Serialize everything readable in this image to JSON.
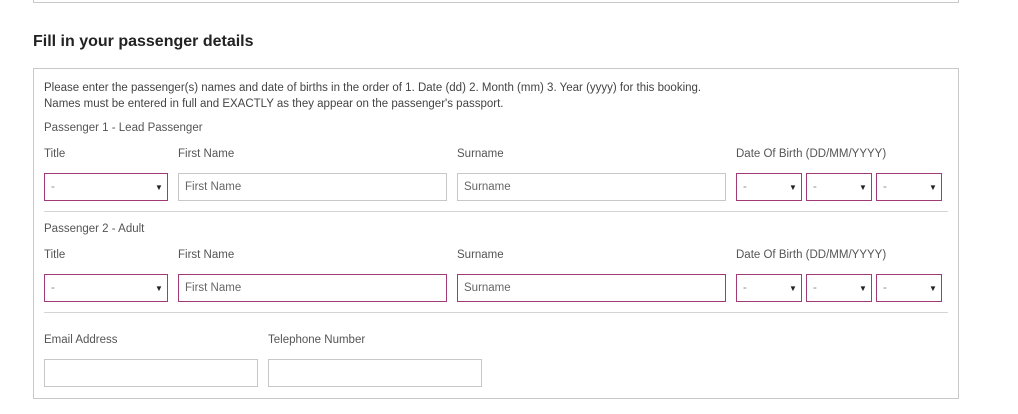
{
  "section_title": "Fill in your passenger details",
  "intro_line1": "Please enter the passenger(s) names and date of births in the order of 1. Date (dd) 2. Month (mm) 3. Year (yyyy) for this booking.",
  "intro_line2": "Names must be entered in full and EXACTLY as they appear on the passenger's passport.",
  "labels": {
    "title": "Title",
    "first_name": "First Name",
    "surname": "Surname",
    "dob": "Date Of Birth (DD/MM/YYYY)",
    "email": "Email Address",
    "telephone": "Telephone Number"
  },
  "passengers": [
    {
      "heading": "Passenger 1 - Lead Passenger",
      "title_value": "-",
      "first_name_placeholder": "First Name",
      "surname_placeholder": "Surname",
      "dob_day": "-",
      "dob_month": "-",
      "dob_year": "-"
    },
    {
      "heading": "Passenger 2 - Adult",
      "title_value": "-",
      "first_name_placeholder": "First Name",
      "surname_placeholder": "Surname",
      "dob_day": "-",
      "dob_month": "-",
      "dob_year": "-"
    }
  ],
  "icons": {
    "dropdown": "caret-down-icon"
  },
  "colors": {
    "required_border": "#a33a78",
    "border": "#c7c7c7"
  }
}
